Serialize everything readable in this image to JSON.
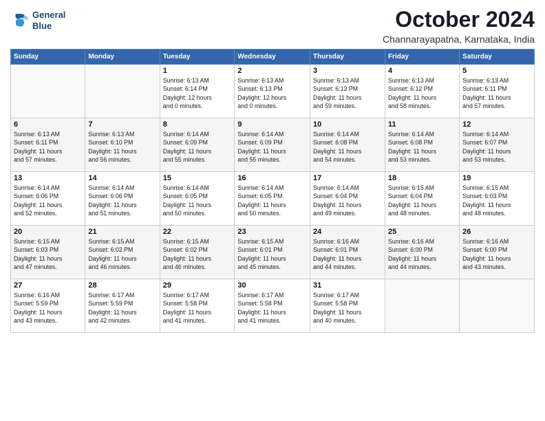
{
  "logo": {
    "line1": "General",
    "line2": "Blue"
  },
  "title": "October 2024",
  "location": "Channarayapatna, Karnataka, India",
  "days_of_week": [
    "Sunday",
    "Monday",
    "Tuesday",
    "Wednesday",
    "Thursday",
    "Friday",
    "Saturday"
  ],
  "weeks": [
    [
      {
        "day": "",
        "info": ""
      },
      {
        "day": "",
        "info": ""
      },
      {
        "day": "1",
        "info": "Sunrise: 6:13 AM\nSunset: 6:14 PM\nDaylight: 12 hours\nand 0 minutes."
      },
      {
        "day": "2",
        "info": "Sunrise: 6:13 AM\nSunset: 6:13 PM\nDaylight: 12 hours\nand 0 minutes."
      },
      {
        "day": "3",
        "info": "Sunrise: 6:13 AM\nSunset: 6:13 PM\nDaylight: 11 hours\nand 59 minutes."
      },
      {
        "day": "4",
        "info": "Sunrise: 6:13 AM\nSunset: 6:12 PM\nDaylight: 11 hours\nand 58 minutes."
      },
      {
        "day": "5",
        "info": "Sunrise: 6:13 AM\nSunset: 6:11 PM\nDaylight: 11 hours\nand 57 minutes."
      }
    ],
    [
      {
        "day": "6",
        "info": "Sunrise: 6:13 AM\nSunset: 6:11 PM\nDaylight: 11 hours\nand 57 minutes."
      },
      {
        "day": "7",
        "info": "Sunrise: 6:13 AM\nSunset: 6:10 PM\nDaylight: 11 hours\nand 56 minutes."
      },
      {
        "day": "8",
        "info": "Sunrise: 6:14 AM\nSunset: 6:09 PM\nDaylight: 11 hours\nand 55 minutes."
      },
      {
        "day": "9",
        "info": "Sunrise: 6:14 AM\nSunset: 6:09 PM\nDaylight: 11 hours\nand 55 minutes."
      },
      {
        "day": "10",
        "info": "Sunrise: 6:14 AM\nSunset: 6:08 PM\nDaylight: 11 hours\nand 54 minutes."
      },
      {
        "day": "11",
        "info": "Sunrise: 6:14 AM\nSunset: 6:08 PM\nDaylight: 11 hours\nand 53 minutes."
      },
      {
        "day": "12",
        "info": "Sunrise: 6:14 AM\nSunset: 6:07 PM\nDaylight: 11 hours\nand 53 minutes."
      }
    ],
    [
      {
        "day": "13",
        "info": "Sunrise: 6:14 AM\nSunset: 6:06 PM\nDaylight: 11 hours\nand 52 minutes."
      },
      {
        "day": "14",
        "info": "Sunrise: 6:14 AM\nSunset: 6:06 PM\nDaylight: 11 hours\nand 51 minutes."
      },
      {
        "day": "15",
        "info": "Sunrise: 6:14 AM\nSunset: 6:05 PM\nDaylight: 11 hours\nand 50 minutes."
      },
      {
        "day": "16",
        "info": "Sunrise: 6:14 AM\nSunset: 6:05 PM\nDaylight: 11 hours\nand 50 minutes."
      },
      {
        "day": "17",
        "info": "Sunrise: 6:14 AM\nSunset: 6:04 PM\nDaylight: 11 hours\nand 49 minutes."
      },
      {
        "day": "18",
        "info": "Sunrise: 6:15 AM\nSunset: 6:04 PM\nDaylight: 11 hours\nand 48 minutes."
      },
      {
        "day": "19",
        "info": "Sunrise: 6:15 AM\nSunset: 6:03 PM\nDaylight: 11 hours\nand 48 minutes."
      }
    ],
    [
      {
        "day": "20",
        "info": "Sunrise: 6:15 AM\nSunset: 6:03 PM\nDaylight: 11 hours\nand 47 minutes."
      },
      {
        "day": "21",
        "info": "Sunrise: 6:15 AM\nSunset: 6:02 PM\nDaylight: 11 hours\nand 46 minutes."
      },
      {
        "day": "22",
        "info": "Sunrise: 6:15 AM\nSunset: 6:02 PM\nDaylight: 11 hours\nand 46 minutes."
      },
      {
        "day": "23",
        "info": "Sunrise: 6:15 AM\nSunset: 6:01 PM\nDaylight: 11 hours\nand 45 minutes."
      },
      {
        "day": "24",
        "info": "Sunrise: 6:16 AM\nSunset: 6:01 PM\nDaylight: 11 hours\nand 44 minutes."
      },
      {
        "day": "25",
        "info": "Sunrise: 6:16 AM\nSunset: 6:00 PM\nDaylight: 11 hours\nand 44 minutes."
      },
      {
        "day": "26",
        "info": "Sunrise: 6:16 AM\nSunset: 6:00 PM\nDaylight: 11 hours\nand 43 minutes."
      }
    ],
    [
      {
        "day": "27",
        "info": "Sunrise: 6:16 AM\nSunset: 5:59 PM\nDaylight: 11 hours\nand 43 minutes."
      },
      {
        "day": "28",
        "info": "Sunrise: 6:17 AM\nSunset: 5:59 PM\nDaylight: 11 hours\nand 42 minutes."
      },
      {
        "day": "29",
        "info": "Sunrise: 6:17 AM\nSunset: 5:58 PM\nDaylight: 11 hours\nand 41 minutes."
      },
      {
        "day": "30",
        "info": "Sunrise: 6:17 AM\nSunset: 5:58 PM\nDaylight: 11 hours\nand 41 minutes."
      },
      {
        "day": "31",
        "info": "Sunrise: 6:17 AM\nSunset: 5:58 PM\nDaylight: 11 hours\nand 40 minutes."
      },
      {
        "day": "",
        "info": ""
      },
      {
        "day": "",
        "info": ""
      }
    ]
  ]
}
